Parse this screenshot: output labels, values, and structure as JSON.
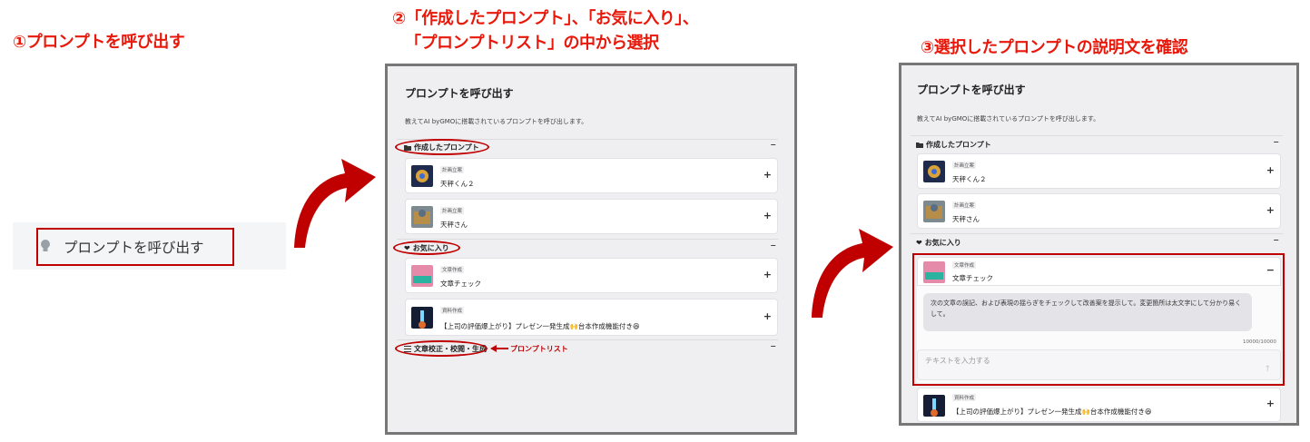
{
  "steps": {
    "step1": "①プロンプトを呼び出す",
    "step2_line1": "②「作成したプロンプト」、「お気に入り」、",
    "step2_line2": "「プロンプトリスト」の中から選択",
    "step3": "③選択したプロンプトの説明文を確認"
  },
  "launcher": {
    "label": "プロンプトを呼び出す",
    "icon": "lightbulb-icon"
  },
  "panel": {
    "title": "プロンプトを呼び出す",
    "description": "教えてAI byGMOに搭載されているプロンプトを呼び出します。",
    "sections": {
      "created": {
        "label": "作成したプロンプト",
        "icon": "folder-icon",
        "toggle": "−"
      },
      "favorites": {
        "label": "お気に入り",
        "icon": "heart-icon",
        "toggle": "−"
      },
      "list": {
        "label": "文章校正・校閲・生成",
        "icon": "list-icon",
        "toggle": "−"
      }
    },
    "cards": {
      "c1": {
        "category": "計画立案",
        "name": "天秤くん２",
        "toggle": "+"
      },
      "c2": {
        "category": "計画立案",
        "name": "天秤さん",
        "toggle": "+"
      },
      "c3": {
        "category": "文章作成",
        "name": "文章チェック",
        "toggle": "+"
      },
      "c4": {
        "category": "資料作成",
        "name": "【上司の評価爆上がり】プレゼン一発生成🙌台本作成機能付き😆",
        "toggle": "+"
      }
    },
    "expanded_toggle": "−"
  },
  "annotation": {
    "list_label": "プロンプトリスト"
  },
  "detail": {
    "description_text": "次の文章の誤記、および表現の揺らぎをチェックして改善案を提示して。変更箇所は太文字にして分かり易くして。",
    "counter": "10000/10000",
    "input_placeholder": "テキストを入力する",
    "send_icon": "↑"
  },
  "colors": {
    "accent_red": "#e8180b",
    "outline_red": "#c00000",
    "panel_bg": "#efeff1"
  }
}
